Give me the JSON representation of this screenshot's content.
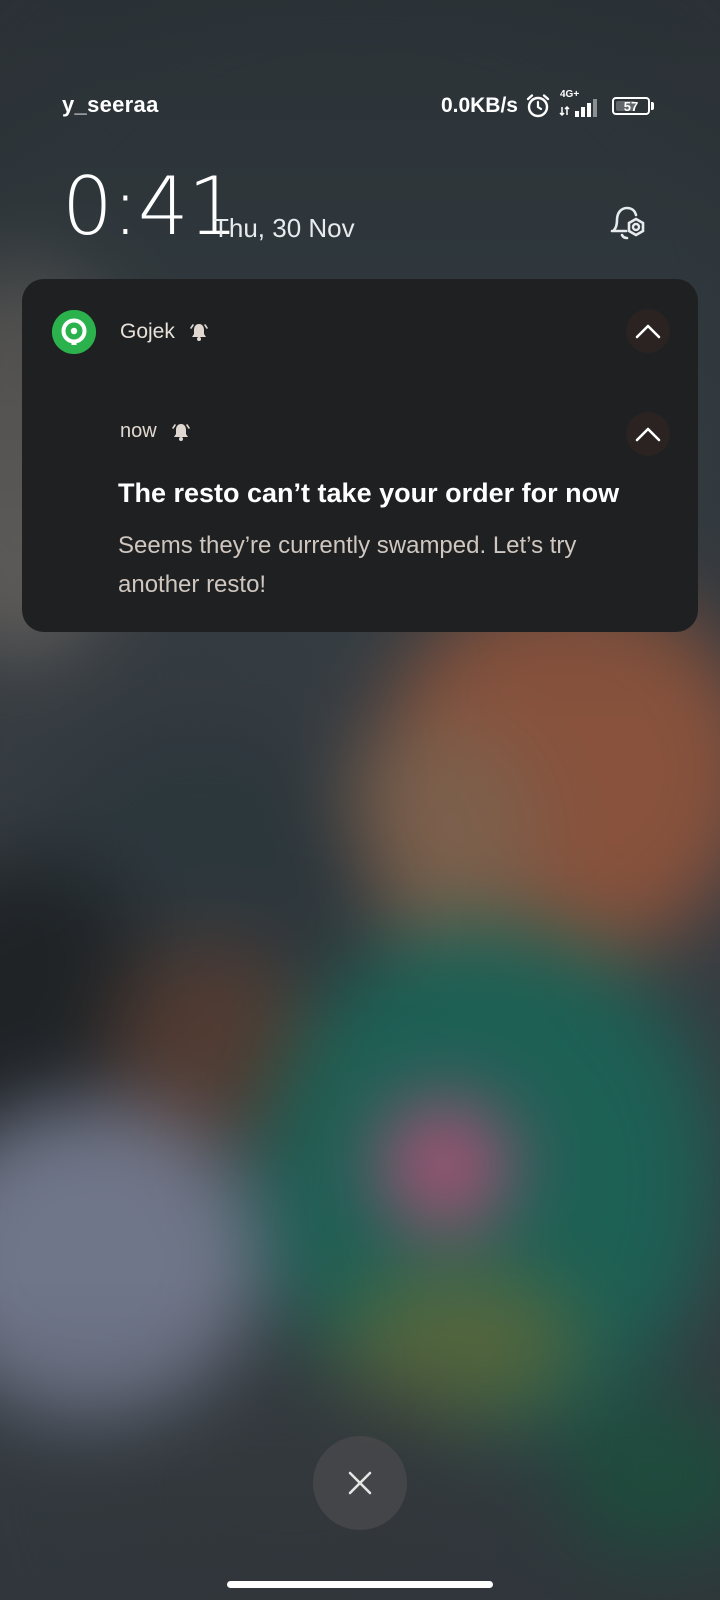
{
  "status_bar": {
    "carrier": "y_seeraa",
    "net_speed": "0.0KB/s",
    "network_type": "4G+",
    "battery_level": "57",
    "icons": [
      "alarm-icon",
      "signal-icon",
      "battery-icon"
    ]
  },
  "lockscreen": {
    "time": "0:41",
    "date": "Thu, 30 Nov"
  },
  "notification": {
    "app_name": "Gojek",
    "time": "now",
    "title": "The resto can’t take your order for now",
    "body": "Seems they’re currently swamped. Let’s try another resto!",
    "icons": [
      "gojek-logo-icon",
      "bell-icon",
      "chevron-up-icon"
    ]
  },
  "colors": {
    "card_background": "#1f2022",
    "gojek_green": "#2bb24c"
  }
}
